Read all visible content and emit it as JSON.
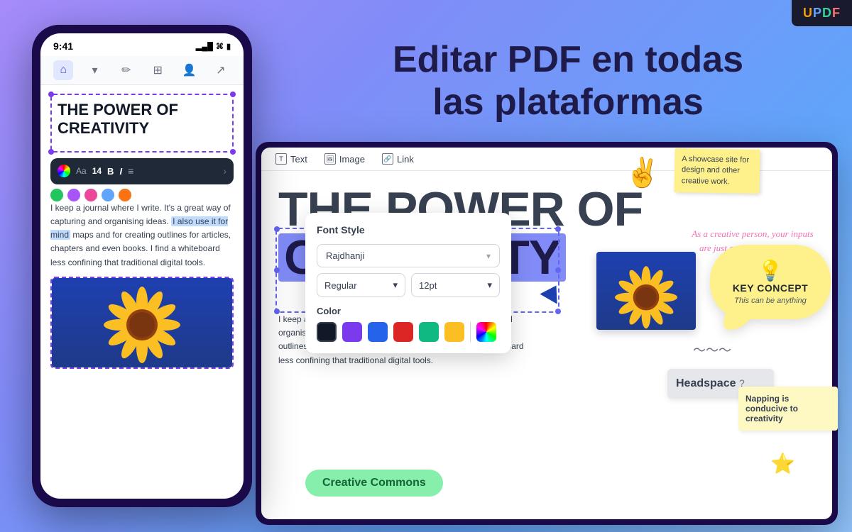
{
  "brand": {
    "name": "UPDF",
    "u": "U",
    "p": "P",
    "d": "D",
    "f": "F"
  },
  "headline": {
    "line1": "Editar PDF en todas",
    "line2": "las plataformas"
  },
  "phone": {
    "status_time": "9:41",
    "signal": "▂▄▆",
    "wifi": "WiFi",
    "battery": "🔋",
    "title": "THE POWER OF CREATIVITY",
    "body_text": "I keep a journal where I write. It's a great way of capturing and organising ideas. ",
    "highlight_text": "I also use it for mind",
    "body_text2": " maps and for creating outlines for articles, chapters and even books. I find a whiteboard less confining that traditional digital tools.",
    "font_size": "14",
    "font_label": "Aa",
    "bold_label": "B",
    "italic_label": "I"
  },
  "tablet": {
    "toolbar": {
      "text_label": "Text",
      "image_label": "Image",
      "link_label": "Link"
    },
    "title_line1": "THE POWER OF",
    "title_line2": "CREATIVITY",
    "body_text": "I keep a journal where I write. It's a great way of capturing and organising ideas. I also use it for mind maps and for creating outlines for articles, chapters and even books. I find a whiteboard less confining that traditional digital tools."
  },
  "font_popup": {
    "title": "Font Style",
    "font_name": "Rajdhanji",
    "weight": "Regular",
    "size": "12pt",
    "color_section": "Color",
    "colors": [
      "#111827",
      "#7c3aed",
      "#2563eb",
      "#dc2626",
      "#10b981",
      "#fbbf24"
    ],
    "chevron": "▾"
  },
  "decorations": {
    "sticky_note": "A showcase site for design and other creative work.",
    "italic_quote": "As a creative person, your inputs are just as important as your outputs",
    "key_concept": "KEY CONCEPT",
    "key_concept_sub": "This can be anything",
    "headspace_label": "Headspace",
    "headspace_q": "?",
    "napping_text": "Napping is conducive to creativity",
    "creative_commons_btn": "Creative Commons",
    "peace_icon": "✌️",
    "lightbulb": "💡",
    "star": "⭐"
  }
}
